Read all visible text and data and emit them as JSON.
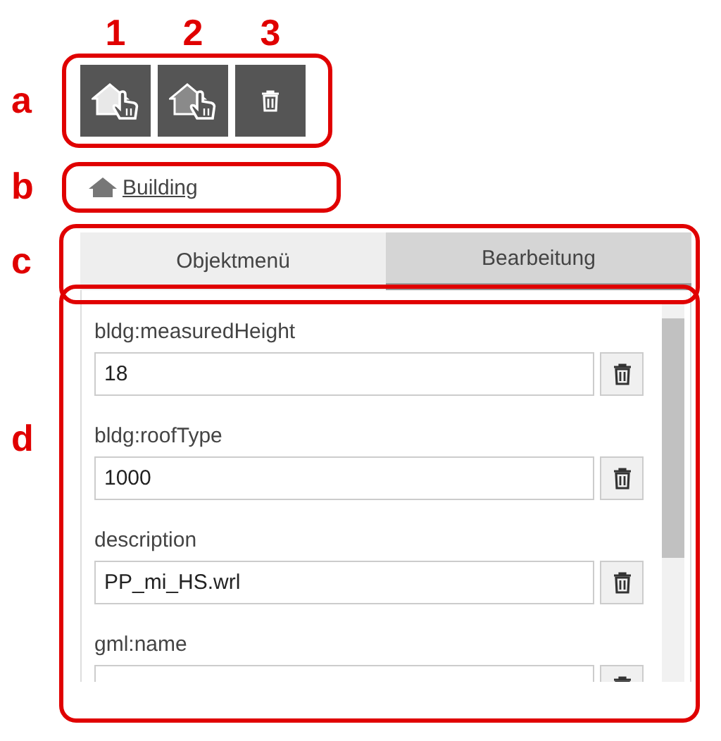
{
  "toolbar": {
    "buttons": [
      {
        "kind": "select-light"
      },
      {
        "kind": "select-dark"
      },
      {
        "kind": "delete"
      }
    ]
  },
  "breadcrumb": {
    "label": "Building"
  },
  "tabs": [
    {
      "label": "Objektmenü",
      "selected": false
    },
    {
      "label": "Bearbeitung",
      "selected": true
    }
  ],
  "attributes": [
    {
      "label": "bldg:measuredHeight",
      "value": "18"
    },
    {
      "label": "bldg:roofType",
      "value": "1000"
    },
    {
      "label": "description",
      "value": "PP_mi_HS.wrl"
    },
    {
      "label": "gml:name"
    }
  ],
  "annotations": {
    "numbers": [
      "1",
      "2",
      "3"
    ],
    "callouts": [
      "a",
      "b",
      "c",
      "d"
    ]
  }
}
